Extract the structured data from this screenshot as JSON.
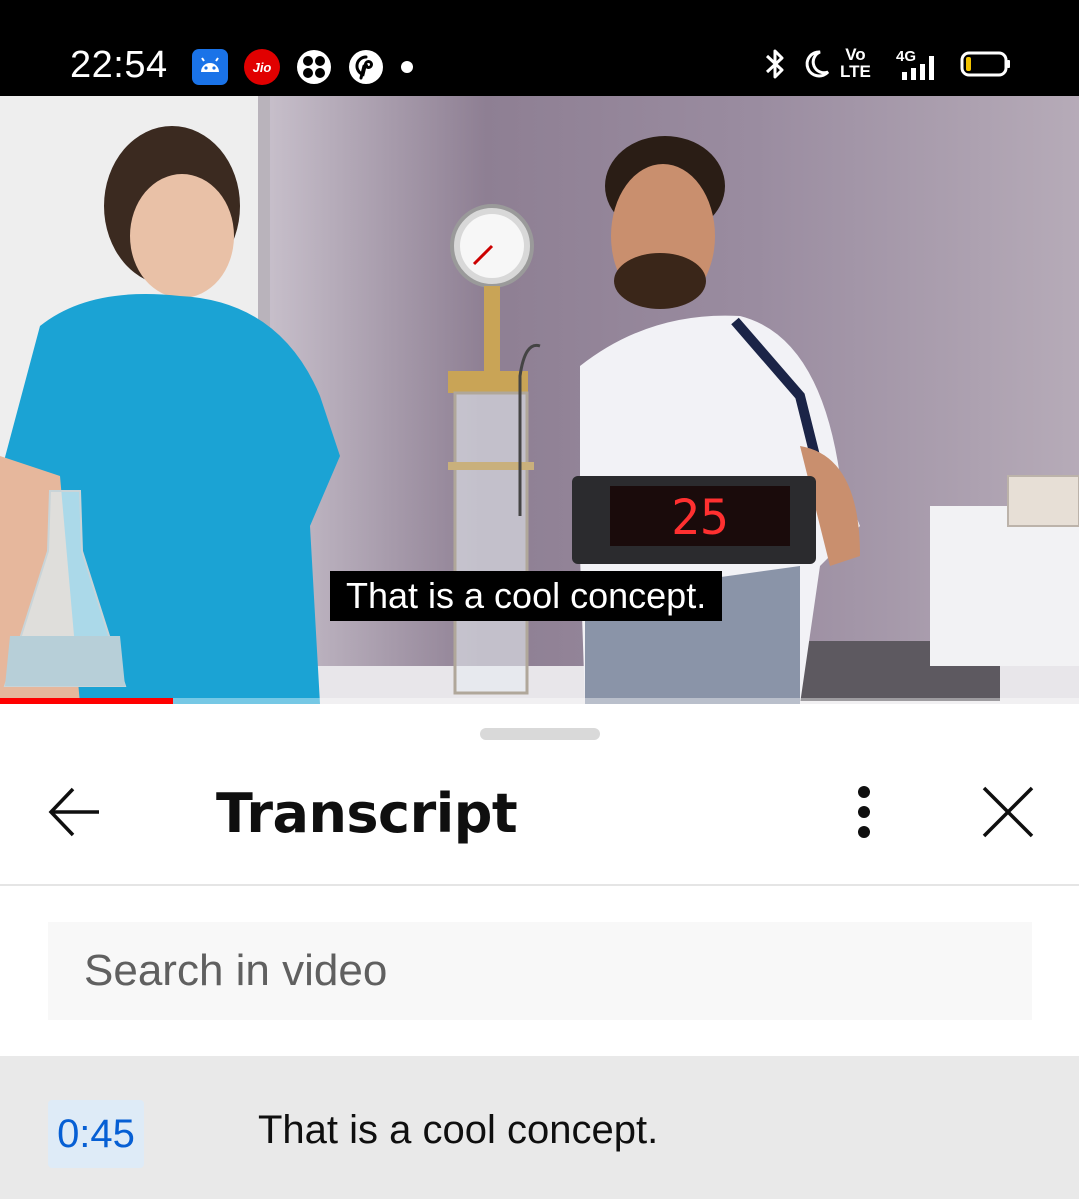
{
  "status_bar": {
    "time": "22:54",
    "left_icons": [
      "android-debug-icon",
      "jio-icon",
      "fan-app-icon",
      "pinterest-icon",
      "notification-dot-icon"
    ],
    "right_icons": [
      "bluetooth-icon",
      "do-not-disturb-moon-icon",
      "volte-icon",
      "signal-4g-icon",
      "battery-icon"
    ],
    "volte_label_top": "Vo",
    "volte_label_bottom": "LTE",
    "network_label": "4G",
    "jio_label": "Jio"
  },
  "video": {
    "caption": "That is a cool concept.",
    "counter_display": "25",
    "progress_fraction": 0.16,
    "colors": {
      "progress": "#ff0000"
    }
  },
  "transcript_panel": {
    "title": "Transcript",
    "search_placeholder": "Search in video",
    "segments": [
      {
        "timestamp": "0:45",
        "text": "That is a cool concept."
      }
    ],
    "colors": {
      "timestamp_text": "#065fd4",
      "timestamp_bg": "#deebf7",
      "active_row_bg": "#e9e9e9"
    }
  }
}
